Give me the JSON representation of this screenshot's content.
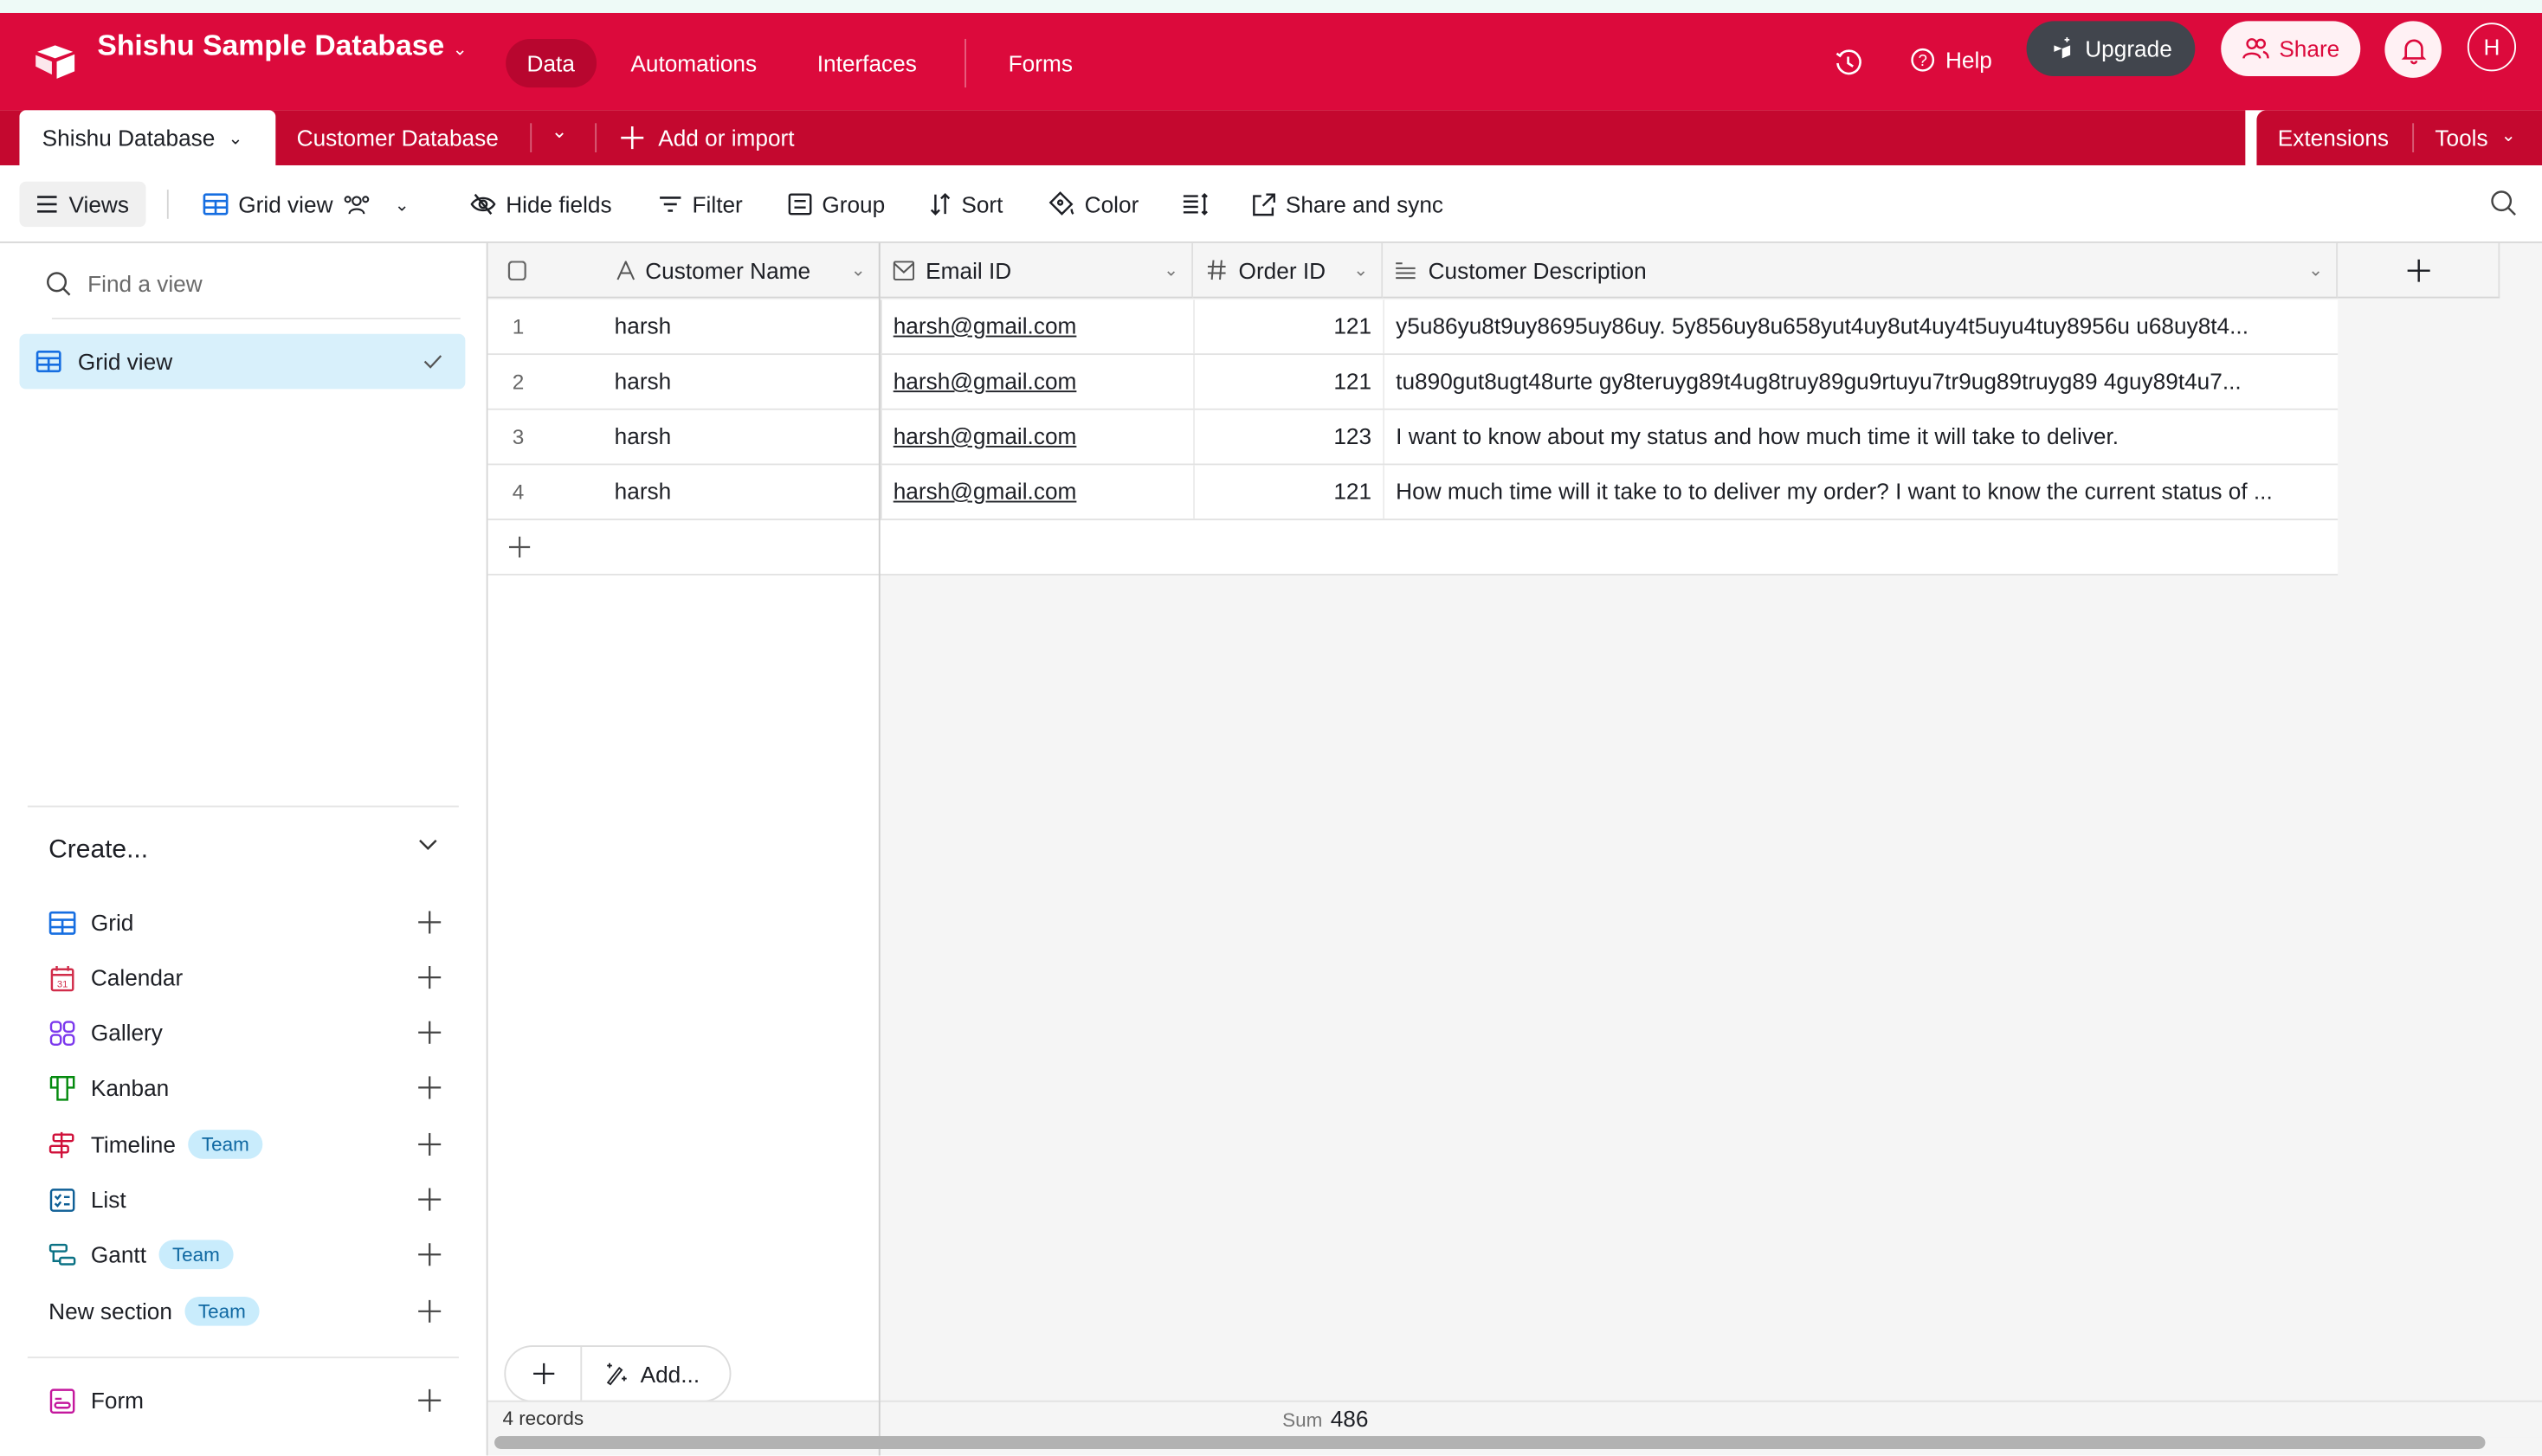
{
  "app": {
    "base_name": "Shishu Sample Database",
    "nav_tabs": [
      {
        "label": "Data",
        "active": true
      },
      {
        "label": "Automations",
        "active": false
      },
      {
        "label": "Interfaces",
        "active": false
      },
      {
        "label": "Forms",
        "active": false
      }
    ],
    "help_label": "Help",
    "upgrade_label": "Upgrade",
    "share_label": "Share",
    "avatar_initial": "H",
    "brand_color": "#dc0a3c"
  },
  "tables": {
    "active": "Shishu Database",
    "others": [
      "Customer Database"
    ],
    "add_label": "Add or import",
    "extensions_label": "Extensions",
    "tools_label": "Tools"
  },
  "toolbar": {
    "views_label": "Views",
    "view_name": "Grid view",
    "hide_fields": "Hide fields",
    "filter": "Filter",
    "group": "Group",
    "sort": "Sort",
    "color": "Color",
    "share_sync": "Share and sync"
  },
  "sidebar": {
    "search_placeholder": "Find a view",
    "views": [
      {
        "label": "Grid view",
        "selected": true
      }
    ],
    "create_title": "Create...",
    "create_items": [
      {
        "label": "Grid",
        "icon": "grid-icon",
        "badge": ""
      },
      {
        "label": "Calendar",
        "icon": "calendar-icon",
        "badge": ""
      },
      {
        "label": "Gallery",
        "icon": "gallery-icon",
        "badge": ""
      },
      {
        "label": "Kanban",
        "icon": "kanban-icon",
        "badge": ""
      },
      {
        "label": "Timeline",
        "icon": "timeline-icon",
        "badge": "Team"
      },
      {
        "label": "List",
        "icon": "list-icon",
        "badge": ""
      },
      {
        "label": "Gantt",
        "icon": "gantt-icon",
        "badge": "Team"
      },
      {
        "label": "New section",
        "icon": "",
        "badge": "Team"
      }
    ],
    "form_item": {
      "label": "Form",
      "icon": "form-icon"
    }
  },
  "grid": {
    "columns": [
      {
        "label": "Customer Name",
        "icon": "text-field-icon"
      },
      {
        "label": "Email ID",
        "icon": "email-field-icon"
      },
      {
        "label": "Order ID",
        "icon": "number-field-icon"
      },
      {
        "label": "Customer Description",
        "icon": "long-text-field-icon"
      }
    ],
    "rows": [
      {
        "num": "1",
        "name": "harsh",
        "email": "harsh@gmail.com",
        "order": "121",
        "desc": "y5u86yu8t9uy8695uy86uy. 5y856uy8u658yut4uy8ut4uy4t5uyu4tuy8956u u68uy8t4..."
      },
      {
        "num": "2",
        "name": "harsh",
        "email": "harsh@gmail.com",
        "order": "121",
        "desc": "tu890gut8ugt48urte gy8teruyg89t4ug8truy89gu9rtuyu7tr9ug89truyg89 4guy89t4u7..."
      },
      {
        "num": "3",
        "name": "harsh",
        "email": "harsh@gmail.com",
        "order": "123",
        "desc": "I want to know about my status and how much time it will take to deliver."
      },
      {
        "num": "4",
        "name": "harsh",
        "email": "harsh@gmail.com",
        "order": "121",
        "desc": "How much time will it take to to deliver my order? I want to know the current status of ..."
      }
    ],
    "add_label": "Add...",
    "record_count": "4 records",
    "sum_label": "Sum",
    "sum_value": "486"
  }
}
